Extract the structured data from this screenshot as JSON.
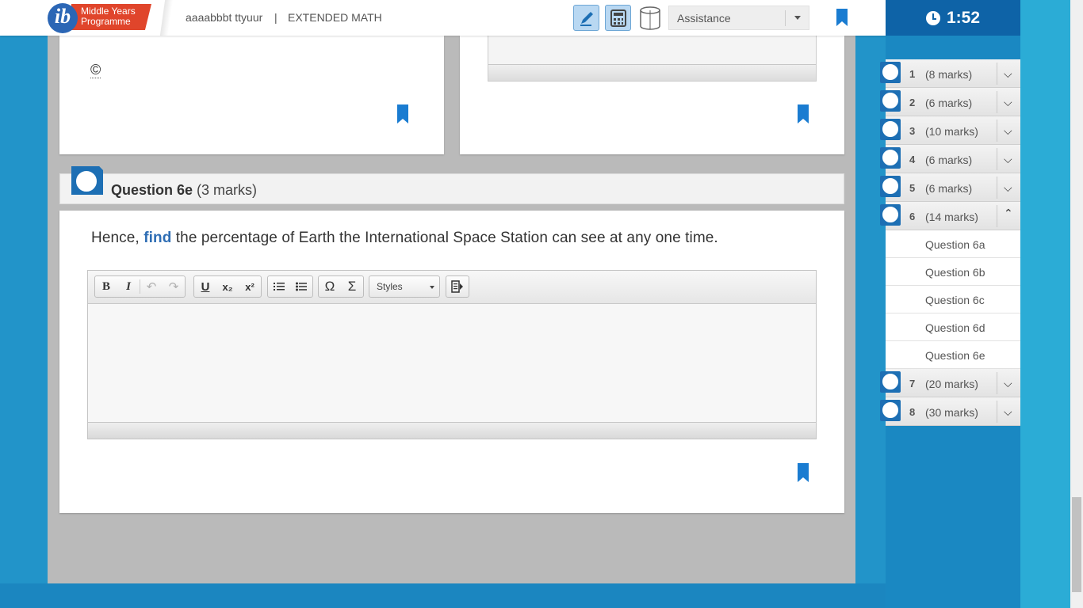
{
  "header": {
    "logo_line1": "Middle Years",
    "logo_line2": "Programme",
    "logo_mark": "ib",
    "user_name": "aaaabbbt ttyuur",
    "separator": "|",
    "subject": "EXTENDED MATH",
    "tools": [
      "pen-icon",
      "calculator-icon",
      "cylinder-icon"
    ],
    "assistance_label": "Assistance"
  },
  "timer": {
    "time": "1:52"
  },
  "cards": {
    "copyright_symbol": "©"
  },
  "question": {
    "title": "Question 6e",
    "marks": "(3 marks)",
    "text_before": "Hence, ",
    "keyword": "find",
    "text_after": " the percentage of Earth the International Space Station can see at any one time."
  },
  "editor": {
    "buttons": [
      "B",
      "I",
      "↶",
      "↷",
      "U",
      "x₂",
      "x²",
      "ordered-list",
      "unordered-list",
      "Ω",
      "Σ"
    ],
    "styles_label": "Styles"
  },
  "nav": {
    "items": [
      {
        "num": "1",
        "marks": "(8 marks)"
      },
      {
        "num": "2",
        "marks": "(6 marks)"
      },
      {
        "num": "3",
        "marks": "(10 marks)"
      },
      {
        "num": "4",
        "marks": "(6 marks)"
      },
      {
        "num": "5",
        "marks": "(6 marks)"
      },
      {
        "num": "6",
        "marks": "(14 marks)"
      },
      {
        "num": "7",
        "marks": "(20 marks)"
      },
      {
        "num": "8",
        "marks": "(30 marks)"
      }
    ],
    "sub_items": [
      "Question 6a",
      "Question 6b",
      "Question 6c",
      "Question 6d",
      "Question 6e"
    ]
  },
  "colors": {
    "accent_blue": "#1d6fb4",
    "brand_orange": "#e0452b",
    "keyword_blue": "#2e6db4"
  }
}
